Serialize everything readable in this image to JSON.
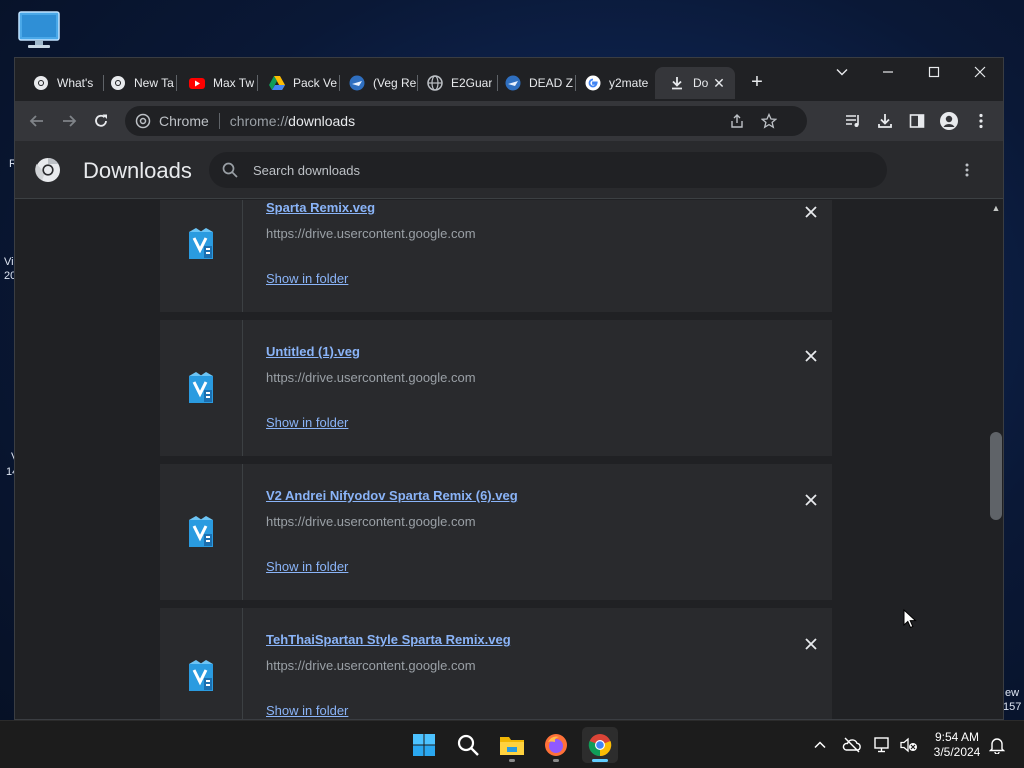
{
  "desktop": {
    "fragments": [
      "R",
      "Vi",
      "20",
      "V",
      "14",
      "ew",
      "157"
    ]
  },
  "tabs": [
    {
      "label": "What's",
      "icon": "chrome-icon"
    },
    {
      "label": "New Ta",
      "icon": "chrome-icon"
    },
    {
      "label": "Max Tw",
      "icon": "youtube-icon"
    },
    {
      "label": "Pack Ve",
      "icon": "google-drive-icon"
    },
    {
      "label": "(Veg Re",
      "icon": "site-icon"
    },
    {
      "label": "E2Guar",
      "icon": "globe-icon"
    },
    {
      "label": "DEAD Z",
      "icon": "site-icon"
    },
    {
      "label": "y2mate",
      "icon": "google-icon"
    },
    {
      "label": "Do",
      "icon": "download-icon",
      "active": true
    }
  ],
  "address_bar": {
    "chip_label": "Chrome",
    "url_prefix": "chrome://",
    "url_path": "downloads"
  },
  "downloads_page": {
    "title": "Downloads",
    "search_placeholder": "Search downloads"
  },
  "download_items": [
    {
      "filename": "Sparta Remix.veg",
      "url": "https://drive.usercontent.google.com",
      "action": "Show in folder"
    },
    {
      "filename": "Untitled (1).veg",
      "url": "https://drive.usercontent.google.com",
      "action": "Show in folder"
    },
    {
      "filename": "V2 Andrei Nifyodov Sparta Remix (6).veg",
      "url": "https://drive.usercontent.google.com",
      "action": "Show in folder"
    },
    {
      "filename": "TehThaiSpartan Style Sparta Remix.veg",
      "url": "https://drive.usercontent.google.com",
      "action": "Show in folder"
    }
  ],
  "taskbar": {
    "time": "9:54 AM",
    "date": "3/5/2024"
  },
  "colors": {
    "link": "#8ab4f8",
    "accent": "#60cdff",
    "window_bg": "#202124"
  }
}
